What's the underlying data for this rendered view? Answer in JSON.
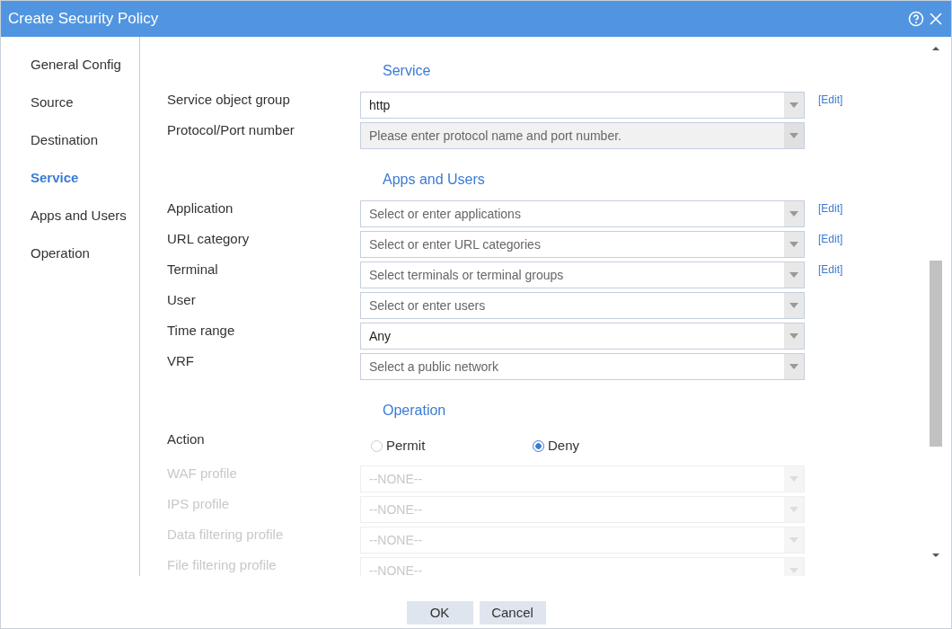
{
  "window": {
    "title": "Create Security Policy"
  },
  "sidebar": {
    "items": [
      {
        "label": "General Config",
        "selected": false
      },
      {
        "label": "Source",
        "selected": false
      },
      {
        "label": "Destination",
        "selected": false
      },
      {
        "label": "Service",
        "selected": true
      },
      {
        "label": "Apps and Users",
        "selected": false
      },
      {
        "label": "Operation",
        "selected": false
      }
    ]
  },
  "sections": [
    {
      "title": "Service",
      "fields": [
        {
          "kind": "select",
          "label": "Service object group",
          "value": "http",
          "disabled": false,
          "edit": "[Edit]"
        },
        {
          "kind": "select",
          "label": "Protocol/Port number",
          "placeholder": "Please enter protocol name and port number.",
          "disabled": false,
          "readonly": true
        }
      ]
    },
    {
      "title": "Apps and Users",
      "fields": [
        {
          "kind": "select",
          "label": "Application",
          "placeholder": "Select or enter applications",
          "disabled": false,
          "edit": "[Edit]"
        },
        {
          "kind": "select",
          "label": "URL category",
          "placeholder": "Select or enter URL categories",
          "disabled": false,
          "edit": "[Edit]"
        },
        {
          "kind": "select",
          "label": "Terminal",
          "placeholder": "Select terminals or terminal groups",
          "disabled": false,
          "edit": "[Edit]"
        },
        {
          "kind": "select",
          "label": "User",
          "placeholder": "Select or enter users",
          "disabled": false
        },
        {
          "kind": "select",
          "label": "Time range",
          "value": "Any",
          "disabled": false
        },
        {
          "kind": "select",
          "label": "VRF",
          "placeholder": "Select a public network",
          "disabled": false
        }
      ]
    },
    {
      "title": "Operation",
      "fields": [
        {
          "kind": "radio",
          "label": "Action",
          "options": [
            {
              "label": "Permit",
              "selected": false
            },
            {
              "label": "Deny",
              "selected": true
            }
          ]
        },
        {
          "kind": "select",
          "label": "WAF profile",
          "value": "--NONE--",
          "disabled": true
        },
        {
          "kind": "select",
          "label": "IPS profile",
          "value": "--NONE--",
          "disabled": true
        },
        {
          "kind": "select",
          "label": "Data filtering profile",
          "value": "--NONE--",
          "disabled": true
        },
        {
          "kind": "select",
          "label": "File filtering profile",
          "value": "--NONE--",
          "disabled": true
        }
      ]
    }
  ],
  "buttons": [
    "OK",
    "Cancel"
  ]
}
